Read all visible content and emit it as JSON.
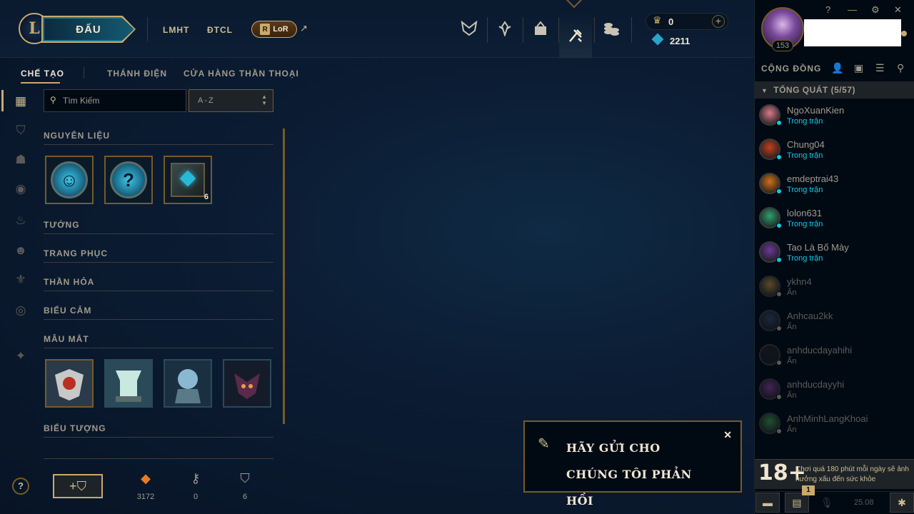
{
  "header": {
    "play_label": "ĐẤU",
    "nav": [
      "LMHT",
      "ĐTCL"
    ],
    "lor_label": "LoR",
    "lor_letter": "R",
    "ext_arrow": "↗",
    "icons": [
      "clash-icon",
      "ranked-icon",
      "collection-icon",
      "loot-icon",
      "store-icon"
    ],
    "blue_essence": "0",
    "riot_points": "2211",
    "plus": "+"
  },
  "profile": {
    "level": "153"
  },
  "window_controls": [
    "?",
    "—",
    "⚙",
    "✕"
  ],
  "subnav": {
    "items": [
      "CHẾ TẠO",
      "THÁNH ĐIỆN",
      "CỬA HÀNG THẦN THOẠI"
    ],
    "active_index": 0
  },
  "search": {
    "placeholder": "Tìm Kiếm",
    "sort_value": "A-Z"
  },
  "sections": {
    "materials": "NGUYÊN LIỆU",
    "champions": "TƯỚNG",
    "skins": "TRANG PHỤC",
    "wards_trinket": "THẦN HỎA",
    "emotes": "BIỂU CẢM",
    "ward_skins": "MẪU MẮT",
    "icons": "BIỂU TƯỢNG"
  },
  "materials_items": [
    {
      "type": "emote-token",
      "glyph": "☺",
      "count": ""
    },
    {
      "type": "mystery-token",
      "glyph": "?",
      "count": ""
    },
    {
      "type": "hextech-chest",
      "glyph": "",
      "count": "6"
    }
  ],
  "bottom_stats": [
    {
      "icon": "orange-essence-icon",
      "glyph": "◆",
      "value": "3172",
      "color": "#e87b22"
    },
    {
      "icon": "key-fragment-icon",
      "glyph": "⚷",
      "value": "0",
      "color": "#a09b8c"
    },
    {
      "icon": "chest-icon",
      "glyph": "⛉",
      "value": "6",
      "color": "#a09b8c"
    }
  ],
  "help": "?",
  "community": {
    "title": "CỘNG ĐỒNG",
    "group_title": "TỔNG QUÁT (5/57)",
    "friends": [
      {
        "name": "NgoXuanKien",
        "status": "Trong trận",
        "online": true,
        "color": "#d87a8a"
      },
      {
        "name": "Chung04",
        "status": "Trong trận",
        "online": true,
        "color": "#c04020"
      },
      {
        "name": "emdeptrai43",
        "status": "Trong trận",
        "online": true,
        "color": "#d0701a"
      },
      {
        "name": "lolon631",
        "status": "Trong trận",
        "online": true,
        "color": "#30a070"
      },
      {
        "name": "Tao Là Bố Mày",
        "status": "Trong trận",
        "online": true,
        "color": "#6a3a9a"
      },
      {
        "name": "ykhn4",
        "status": "Ẩn",
        "online": false,
        "color": "#a08040"
      },
      {
        "name": "Anhcau2kk",
        "status": "Ẩn",
        "online": false,
        "color": "#304060"
      },
      {
        "name": "anhducdayahihi",
        "status": "Ẩn",
        "online": false,
        "color": "#202020"
      },
      {
        "name": "anhducdayyhi",
        "status": "Ẩn",
        "online": false,
        "color": "#7a3a8a"
      },
      {
        "name": "AnhMinhLangKhoai",
        "status": "Ẩn",
        "online": false,
        "color": "#3a8a4a"
      }
    ]
  },
  "age_notice": {
    "rating": "18+",
    "text": "Chơi quá 180 phút mỗi ngày sẽ ảnh hưởng xấu đến sức khỏe"
  },
  "footer": {
    "badge": "1",
    "version": "25.08"
  },
  "toast": {
    "text": "HÃY GỬI CHO CHÚNG TÔI PHẢN HỒI"
  }
}
